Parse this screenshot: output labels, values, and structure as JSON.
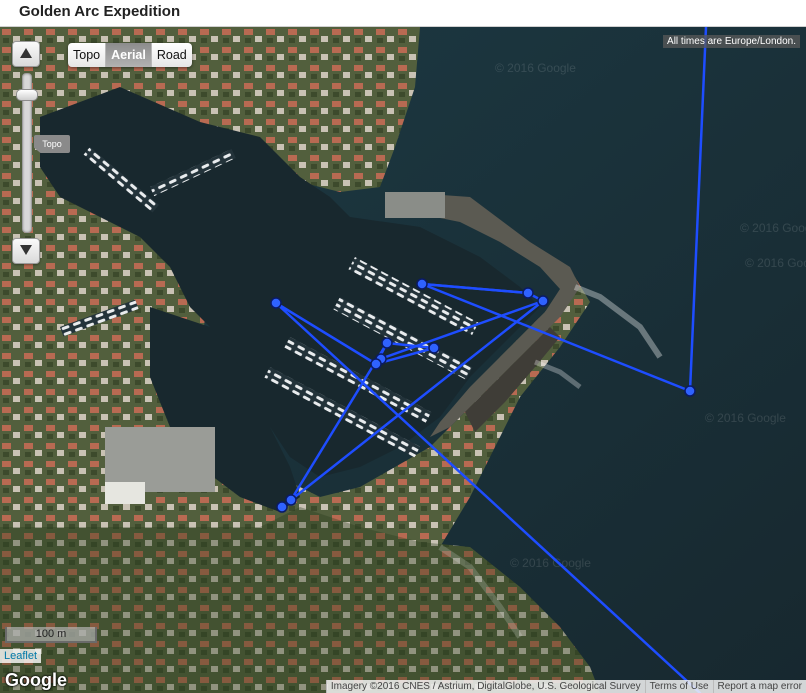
{
  "app": {
    "title": "Golden Arc Expedition"
  },
  "map": {
    "type_buttons": [
      {
        "label": "Topo",
        "active": false
      },
      {
        "label": "Aerial",
        "active": true
      },
      {
        "label": "Road",
        "active": false
      }
    ],
    "zoom_slider": {
      "tag": "Topo"
    },
    "timezone_note": "All times are Europe/London.",
    "scale_label": "100 m",
    "leaflet_label": "Leaflet",
    "google_logo": "Google",
    "watermark": "© 2016 Google",
    "attribution": {
      "imagery": "Imagery ©2016 CNES / Astrium, DigitalGlobe, U.S. Geological Survey",
      "terms": "Terms of Use",
      "report": "Report a map error"
    },
    "colors": {
      "track": "#1e4dff",
      "waypoint_fill": "#2f62ff",
      "waypoint_stroke": "#0a1a66",
      "sea": "#1f3038",
      "land": "#4f5a3a"
    }
  }
}
